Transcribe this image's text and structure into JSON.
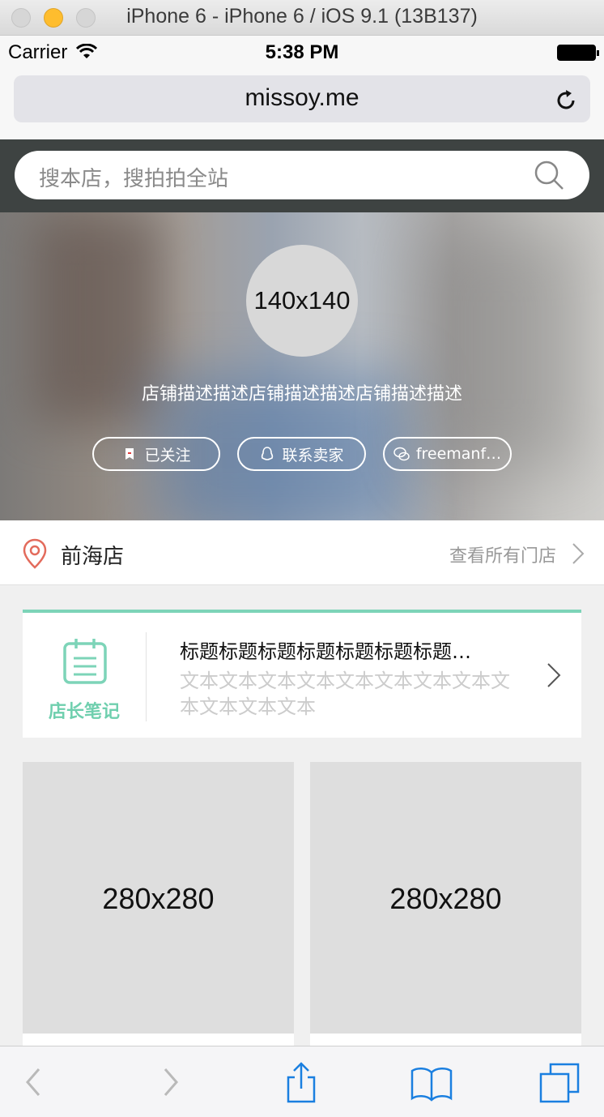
{
  "simulator": {
    "title": "iPhone 6 - iPhone 6 / iOS 9.1 (13B137)"
  },
  "status_bar": {
    "carrier": "Carrier",
    "time": "5:38 PM"
  },
  "browser": {
    "url": "missoy.me"
  },
  "search": {
    "placeholder": "搜本店，搜拍拍全站"
  },
  "shop": {
    "avatar_label": "140x140",
    "description": "店铺描述描述店铺描述描述店铺描述描述",
    "buttons": {
      "follow": "已关注",
      "contact": "联系卖家",
      "wechat": "freemanf…"
    }
  },
  "store_row": {
    "name": "前海店",
    "view_all": "查看所有门店"
  },
  "note": {
    "label": "店长笔记",
    "title": "标题标题标题标题标题标题标题…",
    "text": "文本文本文本文本文本文本文本文本文本文本文本文本"
  },
  "products": [
    {
      "image_label": "280x280"
    },
    {
      "image_label": "280x280"
    }
  ],
  "colors": {
    "accent": "#7dd4b8",
    "search_band": "#3e4342",
    "ios_blue": "#1a7fe0",
    "pin": "#e36b5c"
  },
  "icons": [
    "search-icon",
    "reload-icon",
    "location-pin-icon",
    "chevron-right-icon",
    "notebook-icon",
    "back-icon",
    "forward-icon",
    "share-icon",
    "bookmarks-icon",
    "tabs-icon"
  ]
}
